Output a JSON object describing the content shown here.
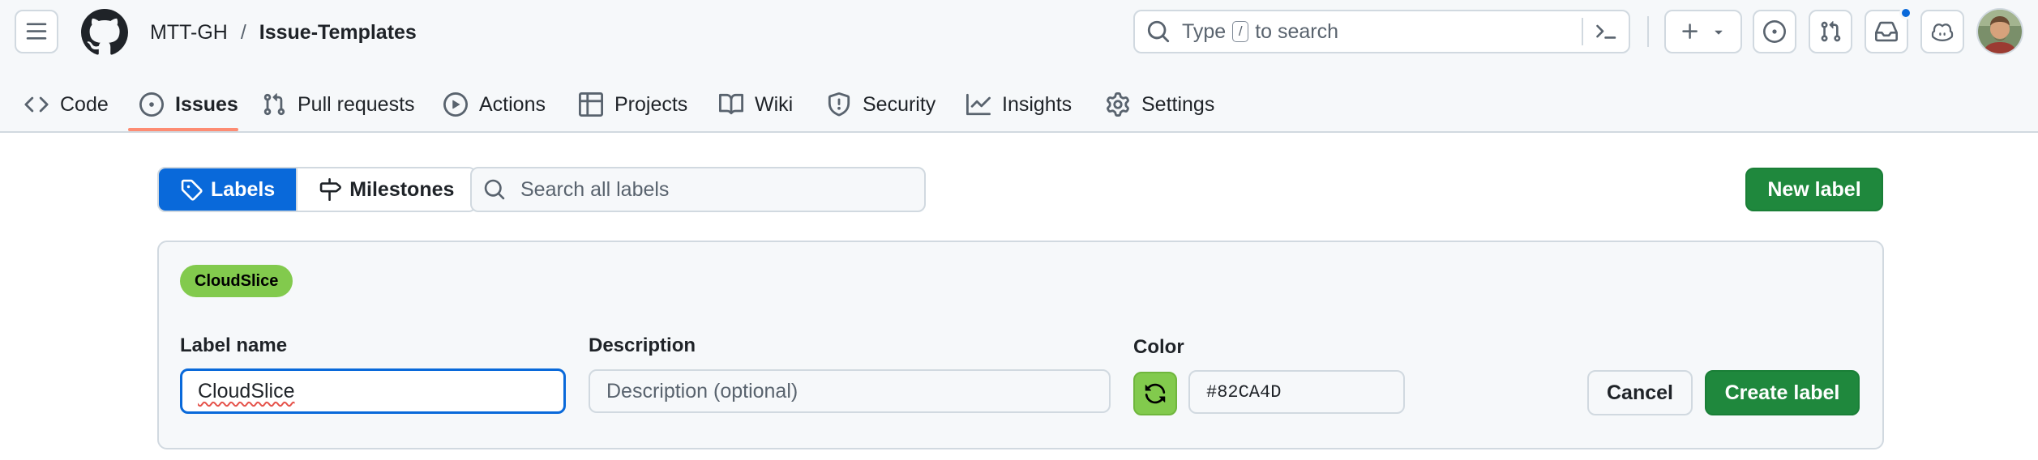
{
  "header": {
    "owner": "MTT-GH",
    "separator": "/",
    "repo": "Issue-Templates",
    "search": {
      "before_key": "Type",
      "key": "/",
      "after_key": "to search"
    },
    "icons": [
      "hamburger-menu-icon",
      "github-logo-icon",
      "search-icon",
      "command-palette-icon",
      "plus-icon",
      "chevron-down-icon",
      "issue-opened-icon",
      "git-pull-request-icon",
      "inbox-icon",
      "copilot-icon"
    ],
    "has_unread_notifications": true
  },
  "repo_tabs": [
    {
      "label": "Code",
      "icon": "code-icon",
      "active": false
    },
    {
      "label": "Issues",
      "icon": "issue-opened-icon",
      "active": true
    },
    {
      "label": "Pull requests",
      "icon": "git-pull-request-icon",
      "active": false
    },
    {
      "label": "Actions",
      "icon": "play-icon",
      "active": false
    },
    {
      "label": "Projects",
      "icon": "table-icon",
      "active": false
    },
    {
      "label": "Wiki",
      "icon": "book-icon",
      "active": false
    },
    {
      "label": "Security",
      "icon": "shield-icon",
      "active": false
    },
    {
      "label": "Insights",
      "icon": "graph-icon",
      "active": false
    },
    {
      "label": "Settings",
      "icon": "gear-icon",
      "active": false
    }
  ],
  "toolbar": {
    "labels_tab": "Labels",
    "milestones_tab": "Milestones",
    "search_placeholder": "Search all labels",
    "new_label": "New label"
  },
  "form": {
    "preview": "CloudSlice",
    "label_name_label": "Label name",
    "label_name_value": "CloudSlice",
    "description_label": "Description",
    "description_placeholder": "Description (optional)",
    "color_label": "Color",
    "color_value": "#82CA4D",
    "cancel": "Cancel",
    "create": "Create label"
  },
  "colors": {
    "label_color": "#82CA4D",
    "primary_green": "#1f883d",
    "selected_blue": "#0969da",
    "active_tab_underline": "#fd8c73"
  }
}
